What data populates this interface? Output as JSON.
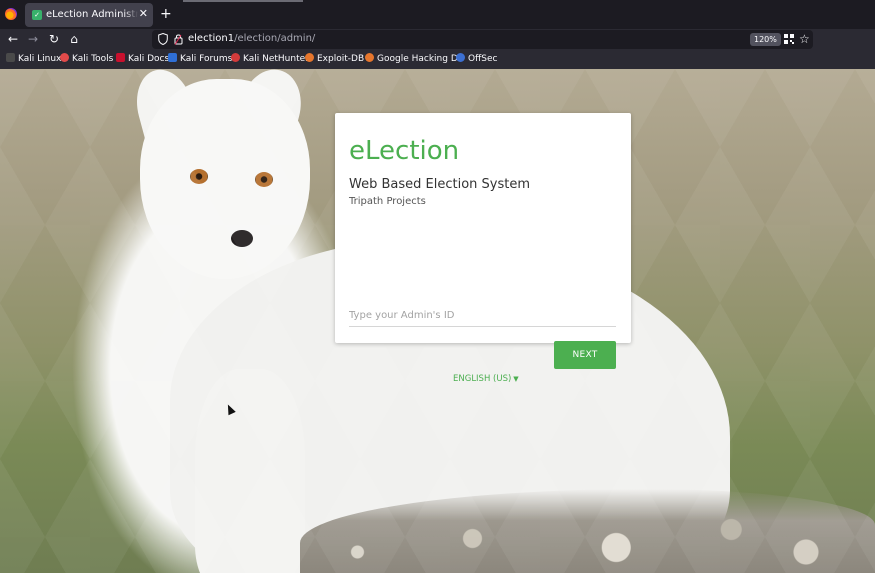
{
  "browser": {
    "tab": {
      "title": "eLection Administration L",
      "close": "✕"
    },
    "new_tab": "+",
    "url": {
      "host": "election1",
      "path": "/election/admin/"
    },
    "zoom": "120%",
    "nav": {
      "back": "←",
      "forward": "→",
      "reload": "↻",
      "home": "⌂"
    },
    "bookmarks": [
      {
        "label": "Kali Linux",
        "color": "#4a4a4a"
      },
      {
        "label": "Kali Tools",
        "color": "#e24a4a"
      },
      {
        "label": "Kali Docs",
        "color": "#c8102e"
      },
      {
        "label": "Kali Forums",
        "color": "#2f6fd6"
      },
      {
        "label": "Kali NetHunter",
        "color": "#d43b3b"
      },
      {
        "label": "Exploit-DB",
        "color": "#e6762d"
      },
      {
        "label": "Google Hacking DB",
        "color": "#e6762d"
      },
      {
        "label": "OffSec",
        "color": "#3c6fd1"
      }
    ]
  },
  "page": {
    "brand": "eLection",
    "subtitle": "Web Based Election System",
    "vendor": "Tripath Projects",
    "admin_id_placeholder": "Type your Admin's ID",
    "next_label": "NEXT",
    "language": "ENGLISH (US)",
    "accent_color": "#4caf50"
  }
}
